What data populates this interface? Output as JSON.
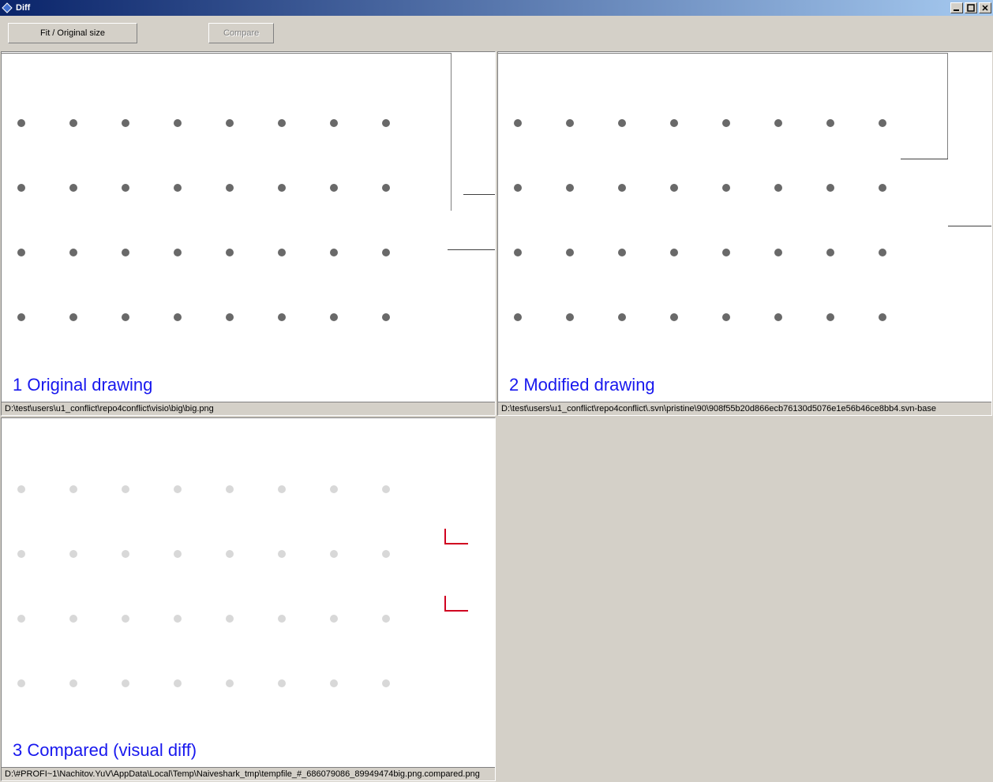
{
  "window": {
    "title": "Diff"
  },
  "toolbar": {
    "fit_label": "Fit / Original size",
    "compare_label": "Compare"
  },
  "panels": {
    "original": {
      "label": "1 Original drawing",
      "path": "D:\\test\\users\\u1_conflict\\repo4conflict\\visio\\big\\big.png"
    },
    "modified": {
      "label": "2 Modified drawing",
      "path": "D:\\test\\users\\u1_conflict\\repo4conflict\\.svn\\pristine\\90\\908f55b20d866ecb76130d5076e1e56b46ce8bb4.svn-base"
    },
    "compared": {
      "label": "3 Compared (visual diff)",
      "path": "D:\\#PROFI~1\\Nachitov.YuV\\AppData\\Local\\Temp\\Naiveshark_tmp\\tempfile_#_686079086_89949474big.png.compared.png"
    }
  }
}
